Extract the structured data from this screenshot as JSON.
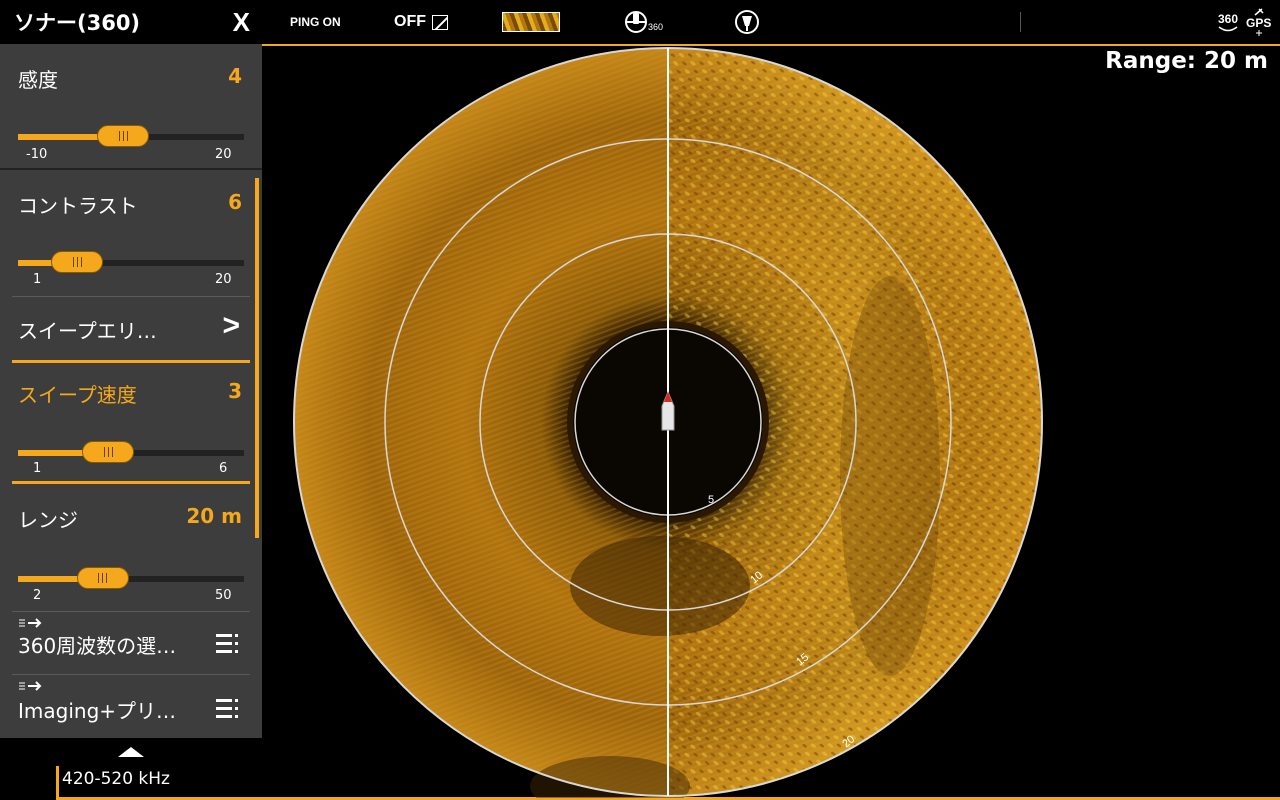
{
  "topbar": {
    "ping_label": "PING ON",
    "off_label": "OFF",
    "mode_360_label": "360",
    "gps_label": "GPS",
    "gps_360_label": "360"
  },
  "panel": {
    "title": "ソナー(360)",
    "close_label": "X",
    "sensitivity": {
      "label": "感度",
      "value": "4",
      "min": "-10",
      "max": "20",
      "level": 4,
      "range": [
        -10,
        20
      ]
    },
    "contrast": {
      "label": "コントラスト",
      "value": "6",
      "min": "1",
      "max": "20",
      "level": 6,
      "range": [
        1,
        20
      ]
    },
    "sweep_area": {
      "label": "スイープエリ…",
      "chevron": ">"
    },
    "sweep_speed": {
      "label": "スイープ速度",
      "value": "3",
      "min": "1",
      "max": "6",
      "level": 3,
      "range": [
        1,
        6
      ]
    },
    "range": {
      "label": "レンジ",
      "value": "20 m",
      "min": "2",
      "max": "50",
      "level": 20,
      "range": [
        2,
        50
      ]
    },
    "freq_select": {
      "label": "360周波数の選…"
    },
    "imaging_preset": {
      "label": "Imaging+プリ…"
    }
  },
  "sonar": {
    "range_text": "Range: 20 m",
    "frequency_text": "420-520 kHz",
    "ring_labels": [
      "5",
      "10",
      "15",
      "20"
    ],
    "colors": {
      "accent": "#f5a81c",
      "sonar_dark": "#3a2404",
      "sonar_mid": "#a86a0c",
      "sonar_bright": "#f0bf32"
    }
  }
}
